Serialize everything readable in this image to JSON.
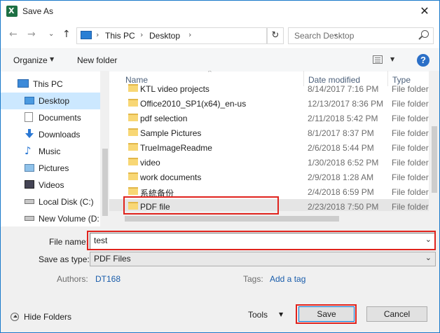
{
  "window": {
    "title": "Save As",
    "close_glyph": "✕"
  },
  "nav": {
    "back_glyph": "←",
    "forward_glyph": "→",
    "up_glyph": "↑",
    "breadcrumb": [
      "This PC",
      "Desktop"
    ],
    "crumb_sep": "›",
    "refresh_glyph": "↻",
    "search_placeholder": "Search Desktop"
  },
  "toolbar": {
    "organize": "Organize",
    "new_folder": "New folder",
    "help": "?"
  },
  "sidebar": {
    "items": [
      {
        "label": "This PC",
        "icon": "computer-icon"
      },
      {
        "label": "Desktop",
        "icon": "desktop-icon",
        "selected": true
      },
      {
        "label": "Documents",
        "icon": "documents-icon"
      },
      {
        "label": "Downloads",
        "icon": "downloads-icon"
      },
      {
        "label": "Music",
        "icon": "music-icon"
      },
      {
        "label": "Pictures",
        "icon": "pictures-icon"
      },
      {
        "label": "Videos",
        "icon": "videos-icon"
      },
      {
        "label": "Local Disk (C:)",
        "icon": "drive-icon"
      },
      {
        "label": "New Volume (D:",
        "icon": "drive-icon"
      }
    ]
  },
  "columns": [
    "Name",
    "Date modified",
    "Type"
  ],
  "files": [
    {
      "name": "KTL video projects",
      "date": "8/14/2017 7:16 PM",
      "type": "File folder"
    },
    {
      "name": "Office2010_SP1(x64)_en-us",
      "date": "12/13/2017 8:36 PM",
      "type": "File folder"
    },
    {
      "name": "pdf selection",
      "date": "2/11/2018 5:42 PM",
      "type": "File folder"
    },
    {
      "name": "Sample Pictures",
      "date": "8/1/2017 8:37 PM",
      "type": "File folder"
    },
    {
      "name": "TrueImageReadme",
      "date": "2/6/2018 5:44 PM",
      "type": "File folder"
    },
    {
      "name": "video",
      "date": "1/30/2018 6:52 PM",
      "type": "File folder"
    },
    {
      "name": "work documents",
      "date": "2/9/2018 1:28 AM",
      "type": "File folder"
    },
    {
      "name": "系統备份",
      "date": "2/4/2018 6:59 PM",
      "type": "File folder"
    },
    {
      "name": "PDF file",
      "date": "2/23/2018 7:50 PM",
      "type": "File folder",
      "selected": true
    }
  ],
  "form": {
    "file_name_label": "File name:",
    "file_name_value": "test",
    "save_type_label": "Save as type:",
    "save_type_value": "PDF Files",
    "authors_label": "Authors:",
    "authors_value": "DT168",
    "tags_label": "Tags:",
    "tags_value": "Add a tag"
  },
  "footer": {
    "hide_folders": "Hide Folders",
    "tools": "Tools",
    "save": "Save",
    "cancel": "Cancel"
  },
  "colors": {
    "accent": "#0078d7",
    "highlight": "#e0231d",
    "selection": "#cce8ff"
  }
}
